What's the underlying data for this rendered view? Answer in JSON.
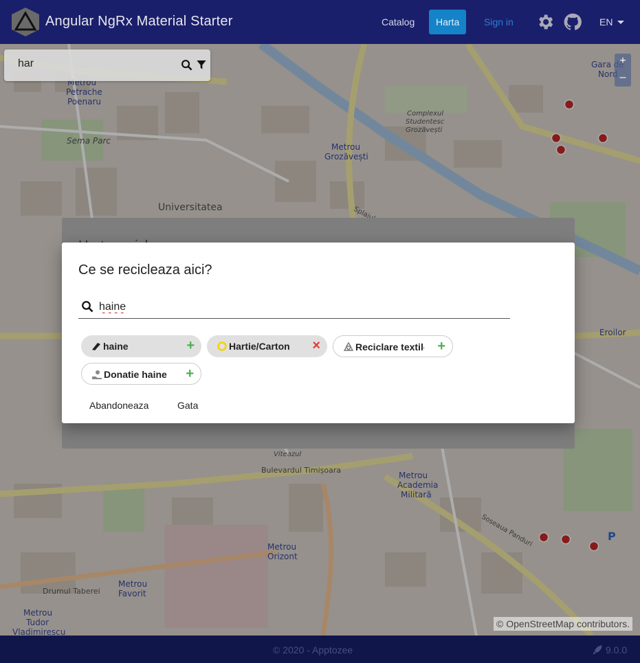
{
  "header": {
    "title": "Angular NgRx Material Starter",
    "nav": {
      "catalog": "Catalog",
      "harta": "Harta",
      "signin": "Sign in"
    },
    "language": "EN"
  },
  "map": {
    "search_value": "har",
    "zoom_in": "+",
    "zoom_out": "–",
    "attribution": "© OpenStreetMap contributors.",
    "labels": [
      "Sema Parc",
      "Universitatea",
      "Metrou Grozăvești",
      "Splaiul Independenței",
      "Bulevardul Timișoara",
      "Metrou Academia Militară",
      "Metrou Orizont",
      "Metrou Favorit",
      "Metrou Tudor Vladimirescu",
      "Soseaua Panduri",
      "Drumul Taberei",
      "Gara de Nord",
      "Metrou Petrache Poenaru",
      "Complex Studentesc Grozăvești",
      "Eroilor",
      "Viteazul"
    ]
  },
  "background_dialog": {
    "title_partial": "Harta reciclare"
  },
  "dialog": {
    "title": "Ce se recicleaza aici?",
    "search_value": "haine",
    "chips": [
      {
        "label": "haine",
        "icon": "shirt-icon",
        "action": "+"
      },
      {
        "label": "Hartie/Carton",
        "icon": "recycle-yellow-icon",
        "action": "×"
      },
      {
        "label": "Reciclare textile",
        "icon": "recycle-icon",
        "action": "+"
      },
      {
        "label": "Donatie haine",
        "icon": "donation-icon",
        "action": "+"
      }
    ],
    "cancel_label": "Abandoneaza",
    "done_label": "Gata"
  },
  "footer": {
    "copyright": "© 2020 - Apptozee",
    "version": "9.0.0"
  },
  "colors": {
    "header": "#1a1f6b",
    "nav_active": "#1583c7",
    "add": "#4caf50",
    "remove": "#e53935"
  }
}
